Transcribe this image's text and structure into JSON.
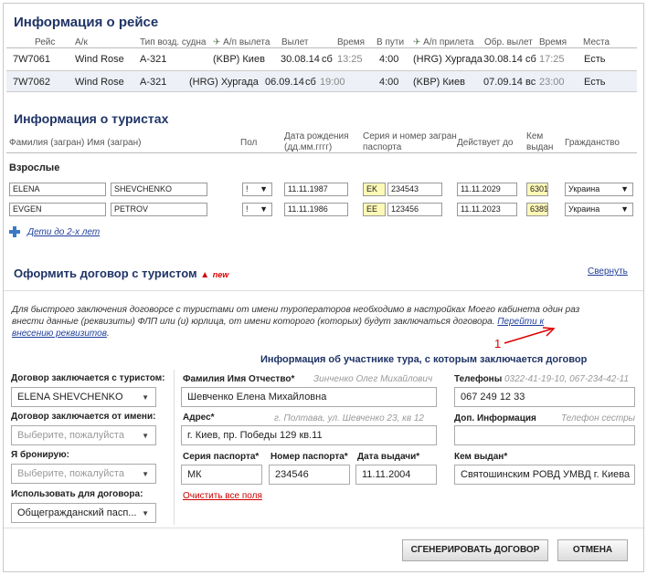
{
  "flight": {
    "title": "Информация о рейсе",
    "headers": {
      "flight": "Рейс",
      "ak": "А/к",
      "aircraft": "Тип возд. судна",
      "dep_airport": "А/п вылета",
      "departure": "Вылет",
      "time": "Время",
      "en_route": "В пути",
      "arr_airport": "А/п прилета",
      "return_dep": "Обр. вылет",
      "time2": "Время",
      "seats": "Места"
    },
    "rows": [
      {
        "flight": "7W7061",
        "ak": "Wind Rose",
        "aircraft": "A-321",
        "dep": "(KBP) Киев",
        "date": "30.08.14",
        "dow": "сб",
        "time": "13:25",
        "dur": "4:00",
        "arr": "(HRG) Хургада",
        "date2": "30.08.14",
        "dow2": "сб",
        "time2": "17:25",
        "seats": "Есть"
      },
      {
        "flight": "7W7062",
        "ak": "Wind Rose",
        "aircraft": "A-321",
        "dep": "(HRG) Хургада",
        "date": "06.09.14",
        "dow": "сб",
        "time": "19:00",
        "dur": "4:00",
        "arr": "(KBP) Киев",
        "date2": "07.09.14",
        "dow2": "вс",
        "time2": "23:00",
        "seats": "Есть"
      }
    ]
  },
  "tourists": {
    "title": "Информация о туристах",
    "headers": {
      "name": "Фамилия (загран) Имя (загран)",
      "sex": "Пол",
      "birth1": "Дата рождения",
      "birth2": "(дд.мм.гггг)",
      "passport1": "Серия и номер загран",
      "passport2": "паспорта",
      "valid": "Действует до",
      "issued1": "Кем",
      "issued2": "выдан",
      "citizenship": "Гражданство"
    },
    "adults_label": "Взрослые",
    "rows": [
      {
        "last": "ELENA",
        "first": "SHEVCHENKO",
        "sex": "!",
        "birth": "11.11.1987",
        "series": "EK",
        "number": "234543",
        "valid": "11.11.2029",
        "issued": "6301",
        "citizenship": "Украина"
      },
      {
        "last": "EVGEN",
        "first": "PETROV",
        "sex": "!",
        "birth": "11.11.1986",
        "series": "EE",
        "number": "123456",
        "valid": "11.11.2023",
        "issued": "6389",
        "citizenship": "Украина"
      }
    ],
    "children_link": "Дети до 2-х лет"
  },
  "contract": {
    "title": "Оформить договор с туристом",
    "new_badge": "new",
    "collapse": "Свернуть",
    "info_text": "Для быстрого заключения договорсе с туристами от имени туроператоров необходимо в настройках Моего кабинета один раз внести данные (реквизиты) ФЛП или (и) юрлица, от имени которого (которых) будут заключаться договора.",
    "info_link": "Перейти к внесению реквизитов",
    "info_tail": ".",
    "annotation": "1",
    "participant_title": "Информация об участнике тура, с которым заключается договор",
    "left": {
      "with_tourist_label": "Договор заключается с туристом:",
      "with_tourist_value": "ELENA SHEVCHENKO",
      "on_behalf_label": "Договор заключается от имени:",
      "on_behalf_placeholder": "Выберите, пожалуйста",
      "booking_label": "Я бронирую:",
      "booking_placeholder": "Выберите, пожалуйста",
      "use_label": "Использовать для договора:",
      "use_value": "Общегражданский пасп..."
    },
    "fields": {
      "fio_label": "Фамилия Имя Отчество*",
      "fio_hint": "Зинченко Олег Михайлович",
      "fio_value": "Шевченко Елена Михайловна",
      "phones_label": "Телефоны",
      "phones_hint": "0322-41-19-10, 067-234-42-11",
      "phones_value": "067 249 12 33",
      "address_label": "Адрес*",
      "address_hint": "г. Полтава, ул. Шевченко 23, кв 12",
      "address_value": "г. Киев, пр. Победы 129 кв.11",
      "extra_label": "Доп. Информация",
      "extra_hint": "Телефон сестры",
      "extra_value": "",
      "series_label": "Серия паспорта*",
      "series_value": "МК",
      "number_label": "Номер паспорта*",
      "number_value": "234546",
      "date_label": "Дата выдачи*",
      "date_value": "11.11.2004",
      "issued_label": "Кем выдан*",
      "issued_value": "Святошинским РОВД УМВД г. Киева",
      "clear": "Очистить все поля"
    },
    "generate_button": "СГЕНЕРИРОВАТЬ ДОГОВОР",
    "cancel_button": "ОТМЕНА"
  }
}
